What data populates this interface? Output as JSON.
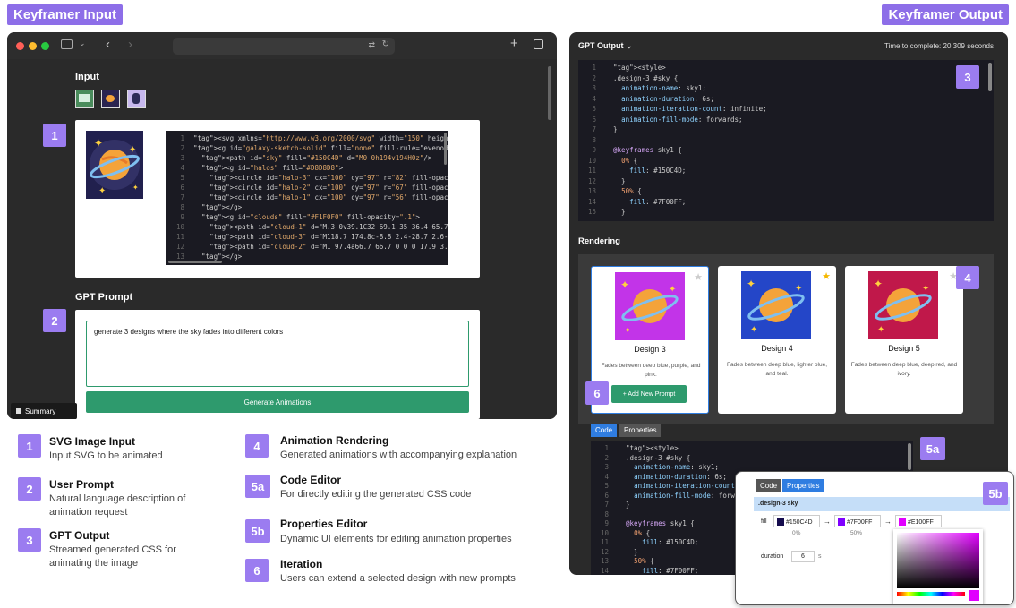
{
  "labels": {
    "input": "Keyframer Input",
    "output": "Keyframer Output"
  },
  "left": {
    "input_title": "Input",
    "gpt_prompt_title": "GPT Prompt",
    "prompt_text": "generate 3 designs where the sky fades into different colors",
    "generate_button": "Generate Animations",
    "summary_button": "Summary",
    "svg_code": [
      {
        "n": "1",
        "t": "<svg xmlns=\"http://www.w3.org/2000/svg\" width=\"150\" height"
      },
      {
        "n": "2",
        "t": "<g id=\"galaxy-sketch-solid\" fill=\"none\" fill-rule=\"evenodd"
      },
      {
        "n": "3",
        "t": "  <path id=\"sky\" fill=\"#150C4D\" d=\"M0 0h194v194H0z\"/>"
      },
      {
        "n": "4",
        "t": "  <g id=\"halos\" fill=\"#D8D8D8\">"
      },
      {
        "n": "5",
        "t": "    <circle id=\"halo-3\" cx=\"100\" cy=\"97\" r=\"82\" fill-opacit"
      },
      {
        "n": "6",
        "t": "    <circle id=\"halo-2\" cx=\"100\" cy=\"97\" r=\"67\" fill-opacit"
      },
      {
        "n": "7",
        "t": "    <circle id=\"halo-1\" cx=\"100\" cy=\"97\" r=\"56\" fill-opacit"
      },
      {
        "n": "8",
        "t": "  </g>"
      },
      {
        "n": "9",
        "t": "  <g id=\"clouds\" fill=\"#F1F0F0\" fill-opacity=\".1\">"
      },
      {
        "n": "10",
        "t": "    <path id=\"cloud-1\" d=\"M.3 0v39.1C32 69.1 35 36.4 65.7 2"
      },
      {
        "n": "11",
        "t": "    <path id=\"cloud-3\" d=\"M118.7 174.8c-8.8 2.4-28.7 2.6-28"
      },
      {
        "n": "12",
        "t": "    <path id=\"cloud-2\" d=\"M1 97.4a66.7 66.7 0 0 0 17.9 3.36"
      },
      {
        "n": "13",
        "t": "  </g>"
      }
    ]
  },
  "right": {
    "gpt_output": "GPT Output",
    "time": "Time to complete: 20.309 seconds",
    "rendering_title": "Rendering",
    "css_code": [
      {
        "n": "1",
        "t": "  <style>"
      },
      {
        "n": "2",
        "t": "  .design-3 #sky {"
      },
      {
        "n": "3",
        "t": "    animation-name: sky1;"
      },
      {
        "n": "4",
        "t": "    animation-duration: 6s;"
      },
      {
        "n": "5",
        "t": "    animation-iteration-count: infinite;"
      },
      {
        "n": "6",
        "t": "    animation-fill-mode: forwards;"
      },
      {
        "n": "7",
        "t": "  }"
      },
      {
        "n": "8",
        "t": ""
      },
      {
        "n": "9",
        "t": "  @keyframes sky1 {"
      },
      {
        "n": "10",
        "t": "    0% {"
      },
      {
        "n": "11",
        "t": "      fill: #150C4D;"
      },
      {
        "n": "12",
        "t": "    }"
      },
      {
        "n": "13",
        "t": "    50% {"
      },
      {
        "n": "14",
        "t": "      fill: #7F00FF;"
      },
      {
        "n": "15",
        "t": "    }"
      }
    ],
    "editor_code": [
      {
        "n": "1",
        "t": "  <style>"
      },
      {
        "n": "2",
        "t": "  .design-3 #sky {"
      },
      {
        "n": "3",
        "t": "    animation-name: sky1;"
      },
      {
        "n": "4",
        "t": "    animation-duration: 6s;"
      },
      {
        "n": "5",
        "t": "    animation-iteration-count:"
      },
      {
        "n": "6",
        "t": "    animation-fill-mode: forwa"
      },
      {
        "n": "7",
        "t": "  }"
      },
      {
        "n": "8",
        "t": ""
      },
      {
        "n": "9",
        "t": "  @keyframes sky1 {"
      },
      {
        "n": "10",
        "t": "    0% {"
      },
      {
        "n": "11",
        "t": "      fill: #150C4D;"
      },
      {
        "n": "12",
        "t": "    }"
      },
      {
        "n": "13",
        "t": "    50% {"
      },
      {
        "n": "14",
        "t": "      fill: #7F00FF;"
      }
    ],
    "designs": [
      {
        "title": "Design 3",
        "desc": "Fades between deep blue, purple, and pink.",
        "bg": "#c234e8",
        "starred": false
      },
      {
        "title": "Design 4",
        "desc": "Fades between deep blue, lighter blue, and teal.",
        "bg": "#2446c8",
        "starred": true
      },
      {
        "title": "Design 5",
        "desc": "Fades between deep blue, deep red, and ivory.",
        "bg": "#c0184a",
        "starred": false
      }
    ],
    "add_prompt": "+ Add New Prompt",
    "tab_code": "Code",
    "tab_properties": "Properties",
    "props": {
      "selector": ".design-3 sky",
      "fill_label": "fill",
      "color1": "#150C4D",
      "color2": "#7F00FF",
      "color3": "#E100FF",
      "pct1": "0%",
      "pct2": "50%",
      "arrow": "→",
      "duration_label": "duration",
      "duration_value": "6",
      "duration_unit": "s"
    }
  },
  "badges": {
    "b1": "1",
    "b2": "2",
    "b3": "3",
    "b4": "4",
    "b5a": "5a",
    "b5b": "5b",
    "b6": "6"
  },
  "legend": [
    {
      "num": "1",
      "title": "SVG Image Input",
      "desc": "Input SVG to be animated"
    },
    {
      "num": "2",
      "title": "User Prompt",
      "desc": "Natural language description of animation request"
    },
    {
      "num": "3",
      "title": "GPT Output",
      "desc": "Streamed generated CSS for animating the image"
    },
    {
      "num": "4",
      "title": "Animation Rendering",
      "desc": "Generated animations with accompanying explanation"
    },
    {
      "num": "5a",
      "title": "Code Editor",
      "desc": "For directly editing the generated CSS code"
    },
    {
      "num": "5b",
      "title": "Properties Editor",
      "desc": "Dynamic UI elements for editing animation properties"
    },
    {
      "num": "6",
      "title": "Iteration",
      "desc": "Users can extend a selected design with new prompts"
    }
  ]
}
